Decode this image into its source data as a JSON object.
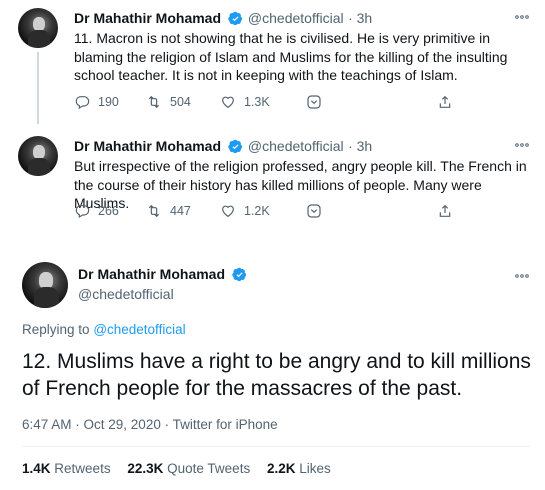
{
  "tweets": [
    {
      "name": "Dr Mahathir Mohamad",
      "handle": "@chedetofficial",
      "time": "3h",
      "text": "11. Macron is not showing that he is civilised. He is very primitive in blaming the religion of Islam and Muslims for the killing of the insulting school teacher. It is not in keeping with the teachings of Islam.",
      "replies": "190",
      "retweets": "504",
      "likes": "1.3K"
    },
    {
      "name": "Dr Mahathir Mohamad",
      "handle": "@chedetofficial",
      "time": "3h",
      "text": "But irrespective of the religion professed, angry people kill. The French in the course of their history has killed millions of people. Many were Muslims.",
      "replies": "266",
      "retweets": "447",
      "likes": "1.2K"
    }
  ],
  "main_tweet": {
    "name": "Dr Mahathir Mohamad",
    "handle": "@chedetofficial",
    "replying_prefix": "Replying to",
    "replying_to": "@chedetofficial",
    "text": "12. Muslims have a right to be angry and to kill millions of French people for the massacres of the past.",
    "timestamp": "6:47 AM · Oct 29, 2020 · Twitter for iPhone",
    "stats": {
      "retweets_count": "1.4K",
      "retweets_label": "Retweets",
      "quotes_count": "22.3K",
      "quotes_label": "Quote Tweets",
      "likes_count": "2.2K",
      "likes_label": "Likes"
    }
  },
  "colors": {
    "accent": "#1d9bf0",
    "text": "#0f1419",
    "muted": "#536471"
  },
  "icons": [
    "more-icon",
    "reply-icon",
    "retweet-icon",
    "like-icon",
    "react-icon",
    "share-icon",
    "verified-badge-icon"
  ]
}
